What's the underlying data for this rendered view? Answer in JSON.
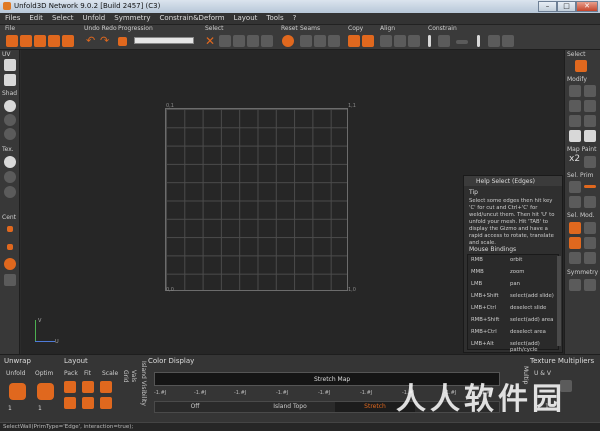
{
  "window": {
    "title": "Unfold3D Network 9.0.2 [Build 2457] (C3)",
    "min": "–",
    "max": "□",
    "close": "✕"
  },
  "menu": [
    "Files",
    "Edit",
    "Select",
    "Unfold",
    "Symmetry",
    "Constrain&Deform",
    "Layout",
    "Tools",
    "?"
  ],
  "toolbar": {
    "groups": {
      "file": "File",
      "undo_redo": "Undo Redo",
      "progression": "Progression",
      "select": "Select",
      "reset": "Reset",
      "seams": "Seams",
      "copy": "Copy",
      "align": "Align",
      "constrain": "Constrain"
    }
  },
  "left_panel": {
    "uv": "UV",
    "shad": "Shad",
    "tex": "Tex.",
    "cent": "Cent"
  },
  "viewport": {
    "corner_tl": "0,1",
    "corner_tr": "1,1",
    "corner_bl": "0,0",
    "corner_br": "1,0",
    "axis_v": "V",
    "axis_u": "U"
  },
  "right_panel": {
    "select": "Select",
    "modify": "Modify",
    "map_paint": "Map Paint",
    "x2": "x2",
    "sel_prim": "Sel. Prim",
    "sel_mod": "Sel. Mod.",
    "symmetry": "Symmetry"
  },
  "help": {
    "title": "Help Select (Edges)",
    "tip_label": "Tip",
    "tip": "Select some edges then hit key 'C' for cut and Ctrl+'C' for weld/uncut them. Then hit 'U' to unfold your mesh. Hit 'TAB' to display the Gizmo and have a rapid access to rotate, translate and scale.",
    "bindings_title": "Mouse Bindings",
    "bindings": [
      {
        "key": "RMB",
        "action": "orbit"
      },
      {
        "key": "MMB",
        "action": "zoom"
      },
      {
        "key": "LMB",
        "action": "pan"
      },
      {
        "key": "LMB+Shift",
        "action": "select(add slide)"
      },
      {
        "key": "LMB+Ctrl",
        "action": "deselect slide"
      },
      {
        "key": "RMB+Shift",
        "action": "select(add) area"
      },
      {
        "key": "RMB+Ctrl",
        "action": "deselect area"
      },
      {
        "key": "LMB+Alt",
        "action": "select(add) path/cycle"
      }
    ]
  },
  "bottom": {
    "unwrap": "Unwrap",
    "unfold": "Unfold",
    "optim": "Optim",
    "unfold_val": "1",
    "optim_val": "1",
    "layout": "Layout",
    "pack": "Pack",
    "fit": "Fit",
    "scale": "Scale",
    "grid": "Grid",
    "vals": "Vals",
    "island_visibility": "Island Visibility",
    "color_display": "Color Display",
    "stretch_map": "Stretch Map",
    "ticks": [
      "-1.#J",
      "-1.#J",
      "-1.#J",
      "-1.#J",
      "-1.#J",
      "-1.#J",
      "-1.#J",
      "-1.#J",
      "-1.#J"
    ],
    "modes": [
      "Off",
      "Island Topo",
      "Stretch"
    ],
    "texture_multipliers": "Texture Multipliers",
    "uv": "U & V",
    "multip": "Multip",
    "tex_val": "1"
  },
  "status": "SelectWall(PrimType='Edge', interaction=true);",
  "watermark": "人人软件园",
  "colors": {
    "accent": "#e0681e",
    "panel": "#383838",
    "viewport": "#262626"
  }
}
